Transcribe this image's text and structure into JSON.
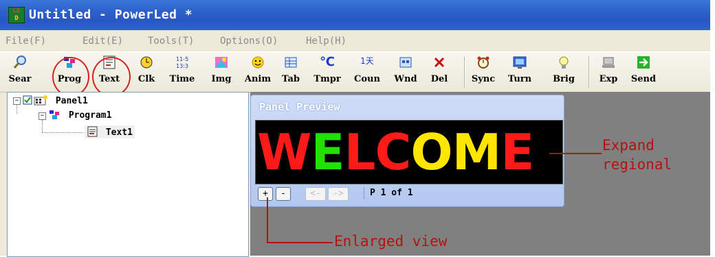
{
  "window": {
    "title": "Untitled - PowerLed *",
    "icon": "led-app-icon"
  },
  "menu": [
    {
      "label": "File(F)"
    },
    {
      "label": "Edit(E)"
    },
    {
      "label": "Tools(T)"
    },
    {
      "label": "Options(O)"
    },
    {
      "label": "Help(H)"
    }
  ],
  "toolbar": [
    {
      "label": "Sear",
      "icon": "search-icon"
    },
    {
      "label": "Prog",
      "icon": "program-icon"
    },
    {
      "label": "Text",
      "icon": "text-icon"
    },
    {
      "label": "Clk",
      "icon": "clock-icon"
    },
    {
      "label": "Time",
      "icon": "time-icon"
    },
    {
      "label": "Img",
      "icon": "image-icon"
    },
    {
      "label": "Anim",
      "icon": "animation-icon"
    },
    {
      "label": "Tab",
      "icon": "table-icon"
    },
    {
      "label": "Tmpr",
      "icon": "temperature-icon"
    },
    {
      "label": "Coun",
      "icon": "countdown-icon"
    },
    {
      "label": "Wnd",
      "icon": "window-icon"
    },
    {
      "label": "Del",
      "icon": "delete-icon"
    },
    {
      "label": "Sync",
      "icon": "sync-icon"
    },
    {
      "label": "Turn",
      "icon": "turn-icon"
    },
    {
      "label": "Brig",
      "icon": "brightness-icon"
    },
    {
      "label": "Exp",
      "icon": "export-icon"
    },
    {
      "label": "Send",
      "icon": "send-icon"
    }
  ],
  "tree": {
    "panel": "Panel1",
    "program": "Program1",
    "text": "Text1"
  },
  "preview": {
    "title": "Panel Preview",
    "led_letters": [
      {
        "char": "W",
        "color": "#ff1a1a"
      },
      {
        "char": "E",
        "color": "#22e000"
      },
      {
        "char": "L",
        "color": "#ff1a1a"
      },
      {
        "char": "C",
        "color": "#ff1a1a"
      },
      {
        "char": "O",
        "color": "#ffe600"
      },
      {
        "char": "M",
        "color": "#ffe600"
      },
      {
        "char": "E",
        "color": "#ff1a1a"
      }
    ],
    "zoom_in": "+",
    "zoom_out": "-",
    "prev": "<-",
    "next": "->",
    "status": "P 1 of 1"
  },
  "annotations": {
    "expand_line1": "Expand",
    "expand_line2": "regional",
    "enlarged": "Enlarged view"
  },
  "colors": {
    "title_bar": "#2d5fcb",
    "annotation": "#b81010",
    "highlight_circle": "#d62020"
  }
}
